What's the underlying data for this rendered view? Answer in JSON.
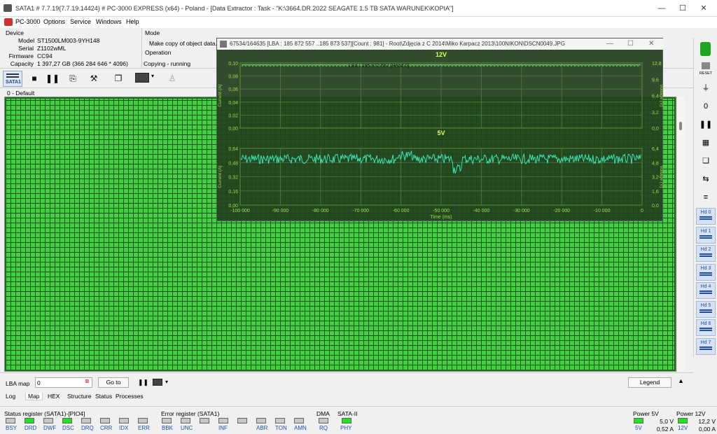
{
  "window": {
    "title": "SATA1 # 7.7.19(7.7.19.14424) # PC-3000 EXPRESS (x64) - Poland - [Data Extractor : Task - \"K:\\3664.DR.2022 SEAGATE 1.5 TB SATA WARUNEK\\KOPIA\"]",
    "minimize": "—",
    "maximize": "☐",
    "close": "✕"
  },
  "menu": [
    "PC-3000",
    "Options",
    "Service",
    "Windows",
    "Help"
  ],
  "device": {
    "header": "Device",
    "model_label": "Model",
    "model": "ST1500LM003-9YH148",
    "serial_label": "Serial",
    "serial": "Z1102wML",
    "firmware_label": "Firmware",
    "firmware": "CC94",
    "capacity_label": "Capacity",
    "capacity": "1 397,27 GB (366 284 646 * 4096)"
  },
  "mode": {
    "header": "Mode",
    "text": "Make copy of object data. Cha",
    "operation_header": "Operation",
    "operation": "Copying - running"
  },
  "toolbar": {
    "sata_label": "SATA1"
  },
  "map": {
    "header": "0 - Default"
  },
  "popup": {
    "title": "67534/164635 [LBA : 185 872 557 ..185 873 537][Count :   981] - Root\\Zdjęcia z C 2014\\Miko Karpacz 2013\\100NIKON\\DSCN0049.JPG",
    "chart_top_title": "12V",
    "chart_bottom_title": "5V",
    "lba_label": "LBA :   185 872 557  [Head 0]",
    "y_left_label_top": "Current (A)",
    "y_right_label_top": "Voltage (V)",
    "y_left_label_bottom": "Current (A)",
    "y_right_label_bottom": "Voltage (V)",
    "x_label": "Time (ms)"
  },
  "chart_data": [
    {
      "type": "line",
      "title": "12V",
      "xlabel": "Time (ms)",
      "ylabel": "Current (A)",
      "y2label": "Voltage (V)",
      "xlim": [
        -100000,
        0
      ],
      "ylim": [
        0,
        0.1
      ],
      "y2lim": [
        0,
        12.8
      ],
      "x_ticks": [
        "-100 000",
        "-90 000",
        "-80 000",
        "-70 000",
        "-60 000",
        "-50 000",
        "-40 000",
        "-30 000",
        "-20 000",
        "-10 000",
        "0"
      ],
      "y_ticks": [
        "0,00",
        "0,02",
        "0,04",
        "0,06",
        "0,08",
        "0,10"
      ],
      "y2_ticks": [
        "0,0",
        "3,2",
        "6,4",
        "9,6",
        "12,8"
      ],
      "series": [
        {
          "kind": "current",
          "values_approx": 0.097
        },
        {
          "kind": "voltage",
          "values_approx": 12.2
        }
      ]
    },
    {
      "type": "line",
      "title": "5V",
      "xlabel": "Time (ms)",
      "ylabel": "Current (A)",
      "y2label": "Voltage (V)",
      "xlim": [
        -100000,
        0
      ],
      "ylim": [
        0,
        0.64
      ],
      "y2lim": [
        0,
        6.4
      ],
      "x_ticks": [
        "-100 000",
        "-90 000",
        "-80 000",
        "-70 000",
        "-60 000",
        "-50 000",
        "-40 000",
        "-30 000",
        "-20 000",
        "-10 000",
        "0"
      ],
      "y_ticks": [
        "0,00",
        "0,16",
        "0,32",
        "0,48",
        "0,64"
      ],
      "y2_ticks": [
        "0,0",
        "1,6",
        "3,2",
        "4,8",
        "6,4"
      ],
      "series": [
        {
          "kind": "current",
          "values_approx": 0.52
        }
      ]
    }
  ],
  "bottombar": {
    "lba_map_label": "LBA map",
    "lba_value": "0",
    "goto_label": "Go to",
    "legend_label": "Legend"
  },
  "tabs": [
    "Log",
    "Map",
    "HEX",
    "Structure",
    "Status",
    "Processes"
  ],
  "status": {
    "status_reg_title": "Status register (SATA1)-[PIO4]",
    "status_leds": [
      {
        "label": "BSY",
        "on": false
      },
      {
        "label": "DRD",
        "on": true
      },
      {
        "label": "DWF",
        "on": false
      },
      {
        "label": "DSC",
        "on": true
      },
      {
        "label": "DRQ",
        "on": false
      },
      {
        "label": "CRR",
        "on": false
      },
      {
        "label": "IDX",
        "on": false
      },
      {
        "label": "ERR",
        "on": false
      }
    ],
    "error_reg_title": "Error register (SATA1)",
    "error_leds": [
      {
        "label": "BBK",
        "on": false
      },
      {
        "label": "UNC",
        "on": false
      },
      {
        "label": "",
        "on": false
      },
      {
        "label": "INF",
        "on": false
      },
      {
        "label": "",
        "on": false
      },
      {
        "label": "ABR",
        "on": false
      },
      {
        "label": "TON",
        "on": false
      },
      {
        "label": "AMN",
        "on": false
      }
    ],
    "dma_title": "DMA",
    "dma_led": {
      "label": "RQ",
      "on": false
    },
    "sata_title": "SATA-II",
    "sata_led": {
      "label": "PHY",
      "on": true
    },
    "power5_title": "Power 5V",
    "power5_led_label": "5V",
    "power5_voltage": "5,0 V",
    "power5_current": "0,52 A",
    "power12_title": "Power 12V",
    "power12_led_label": "12V",
    "power12_voltage": "12,2 V",
    "power12_current": "0,00 A"
  },
  "sidebar": {
    "reset_label": "RESET",
    "heads": [
      "Hd 0",
      "Hd 1",
      "Hd 2",
      "Hd 3",
      "Hd 4",
      "Hd 5",
      "Hd 6",
      "Hd 7"
    ]
  }
}
